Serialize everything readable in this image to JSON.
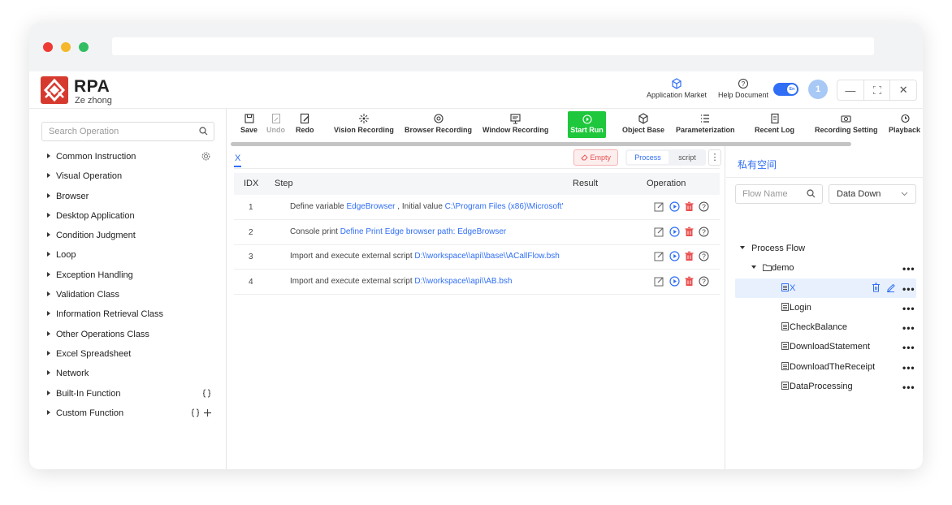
{
  "window": {
    "controls": [
      "close",
      "minimize",
      "maximize"
    ]
  },
  "header": {
    "logo_title": "RPA",
    "logo_subtitle": "Ze zhong",
    "application_market": "Application Market",
    "help_document": "Help Document",
    "lang_toggle": "En",
    "avatar_initial": "1"
  },
  "sidebar": {
    "search_placeholder": "Search Operation",
    "items": [
      {
        "label": "Common Instruction"
      },
      {
        "label": "Visual Operation"
      },
      {
        "label": "Browser"
      },
      {
        "label": "Desktop Application"
      },
      {
        "label": "Condition Judgment"
      },
      {
        "label": "Loop"
      },
      {
        "label": "Exception Handling"
      },
      {
        "label": "Validation Class"
      },
      {
        "label": "Information Retrieval Class"
      },
      {
        "label": "Other Operations Class"
      },
      {
        "label": "Excel Spreadsheet"
      },
      {
        "label": "Network"
      },
      {
        "label": "Built-In Function"
      },
      {
        "label": "Custom Function"
      }
    ]
  },
  "toolbar": {
    "save": "Save",
    "undo": "Undo",
    "redo": "Redo",
    "vision_recording": "Vision Recording",
    "browser_recording": "Browser Recording",
    "window_recording": "Window Recording",
    "start_run": "Start Run",
    "object_base": "Object Base",
    "parameterization": "Parameterization",
    "recent_log": "Recent Log",
    "recording_setting": "Recording Setting",
    "playback": "Playback"
  },
  "editor": {
    "active_tab": "X",
    "empty_button": "Empty",
    "mode_process": "Process",
    "mode_script": "script",
    "columns": {
      "idx": "IDX",
      "step": "Step",
      "result": "Result",
      "operation": "Operation"
    },
    "rows": [
      {
        "idx": "1",
        "prefix": "Define variable ",
        "link1": "EdgeBrowser",
        "middle": " , Initial value ",
        "link2": "C:\\Program Files (x86)\\Microsoft'"
      },
      {
        "idx": "2",
        "prefix": "Console print ",
        "link1": "Define Print Edge browser path: EdgeBrowser",
        "middle": "",
        "link2": ""
      },
      {
        "idx": "3",
        "prefix": "Import and execute external script ",
        "link1": "D:\\\\workspace\\\\api\\\\base\\\\ACallFlow.bsh",
        "middle": "",
        "link2": ""
      },
      {
        "idx": "4",
        "prefix": "Import and execute external script ",
        "link1": "D:\\\\workspace\\\\api\\\\AB.bsh",
        "middle": "",
        "link2": ""
      }
    ]
  },
  "flows": {
    "title": "私有空间",
    "search_placeholder": "Flow Name",
    "data_down": "Data Down",
    "root": "Process Flow",
    "folder": "demo",
    "items": [
      {
        "label": "X",
        "selected": true
      },
      {
        "label": "Login"
      },
      {
        "label": "CheckBalance"
      },
      {
        "label": "DownloadStatement"
      },
      {
        "label": "DownloadTheReceipt"
      },
      {
        "label": "DataProcessing"
      }
    ]
  },
  "colors": {
    "accent": "#2f6ef5",
    "run": "#1ec73b",
    "danger": "#e85050",
    "logo": "#d63a2f"
  }
}
